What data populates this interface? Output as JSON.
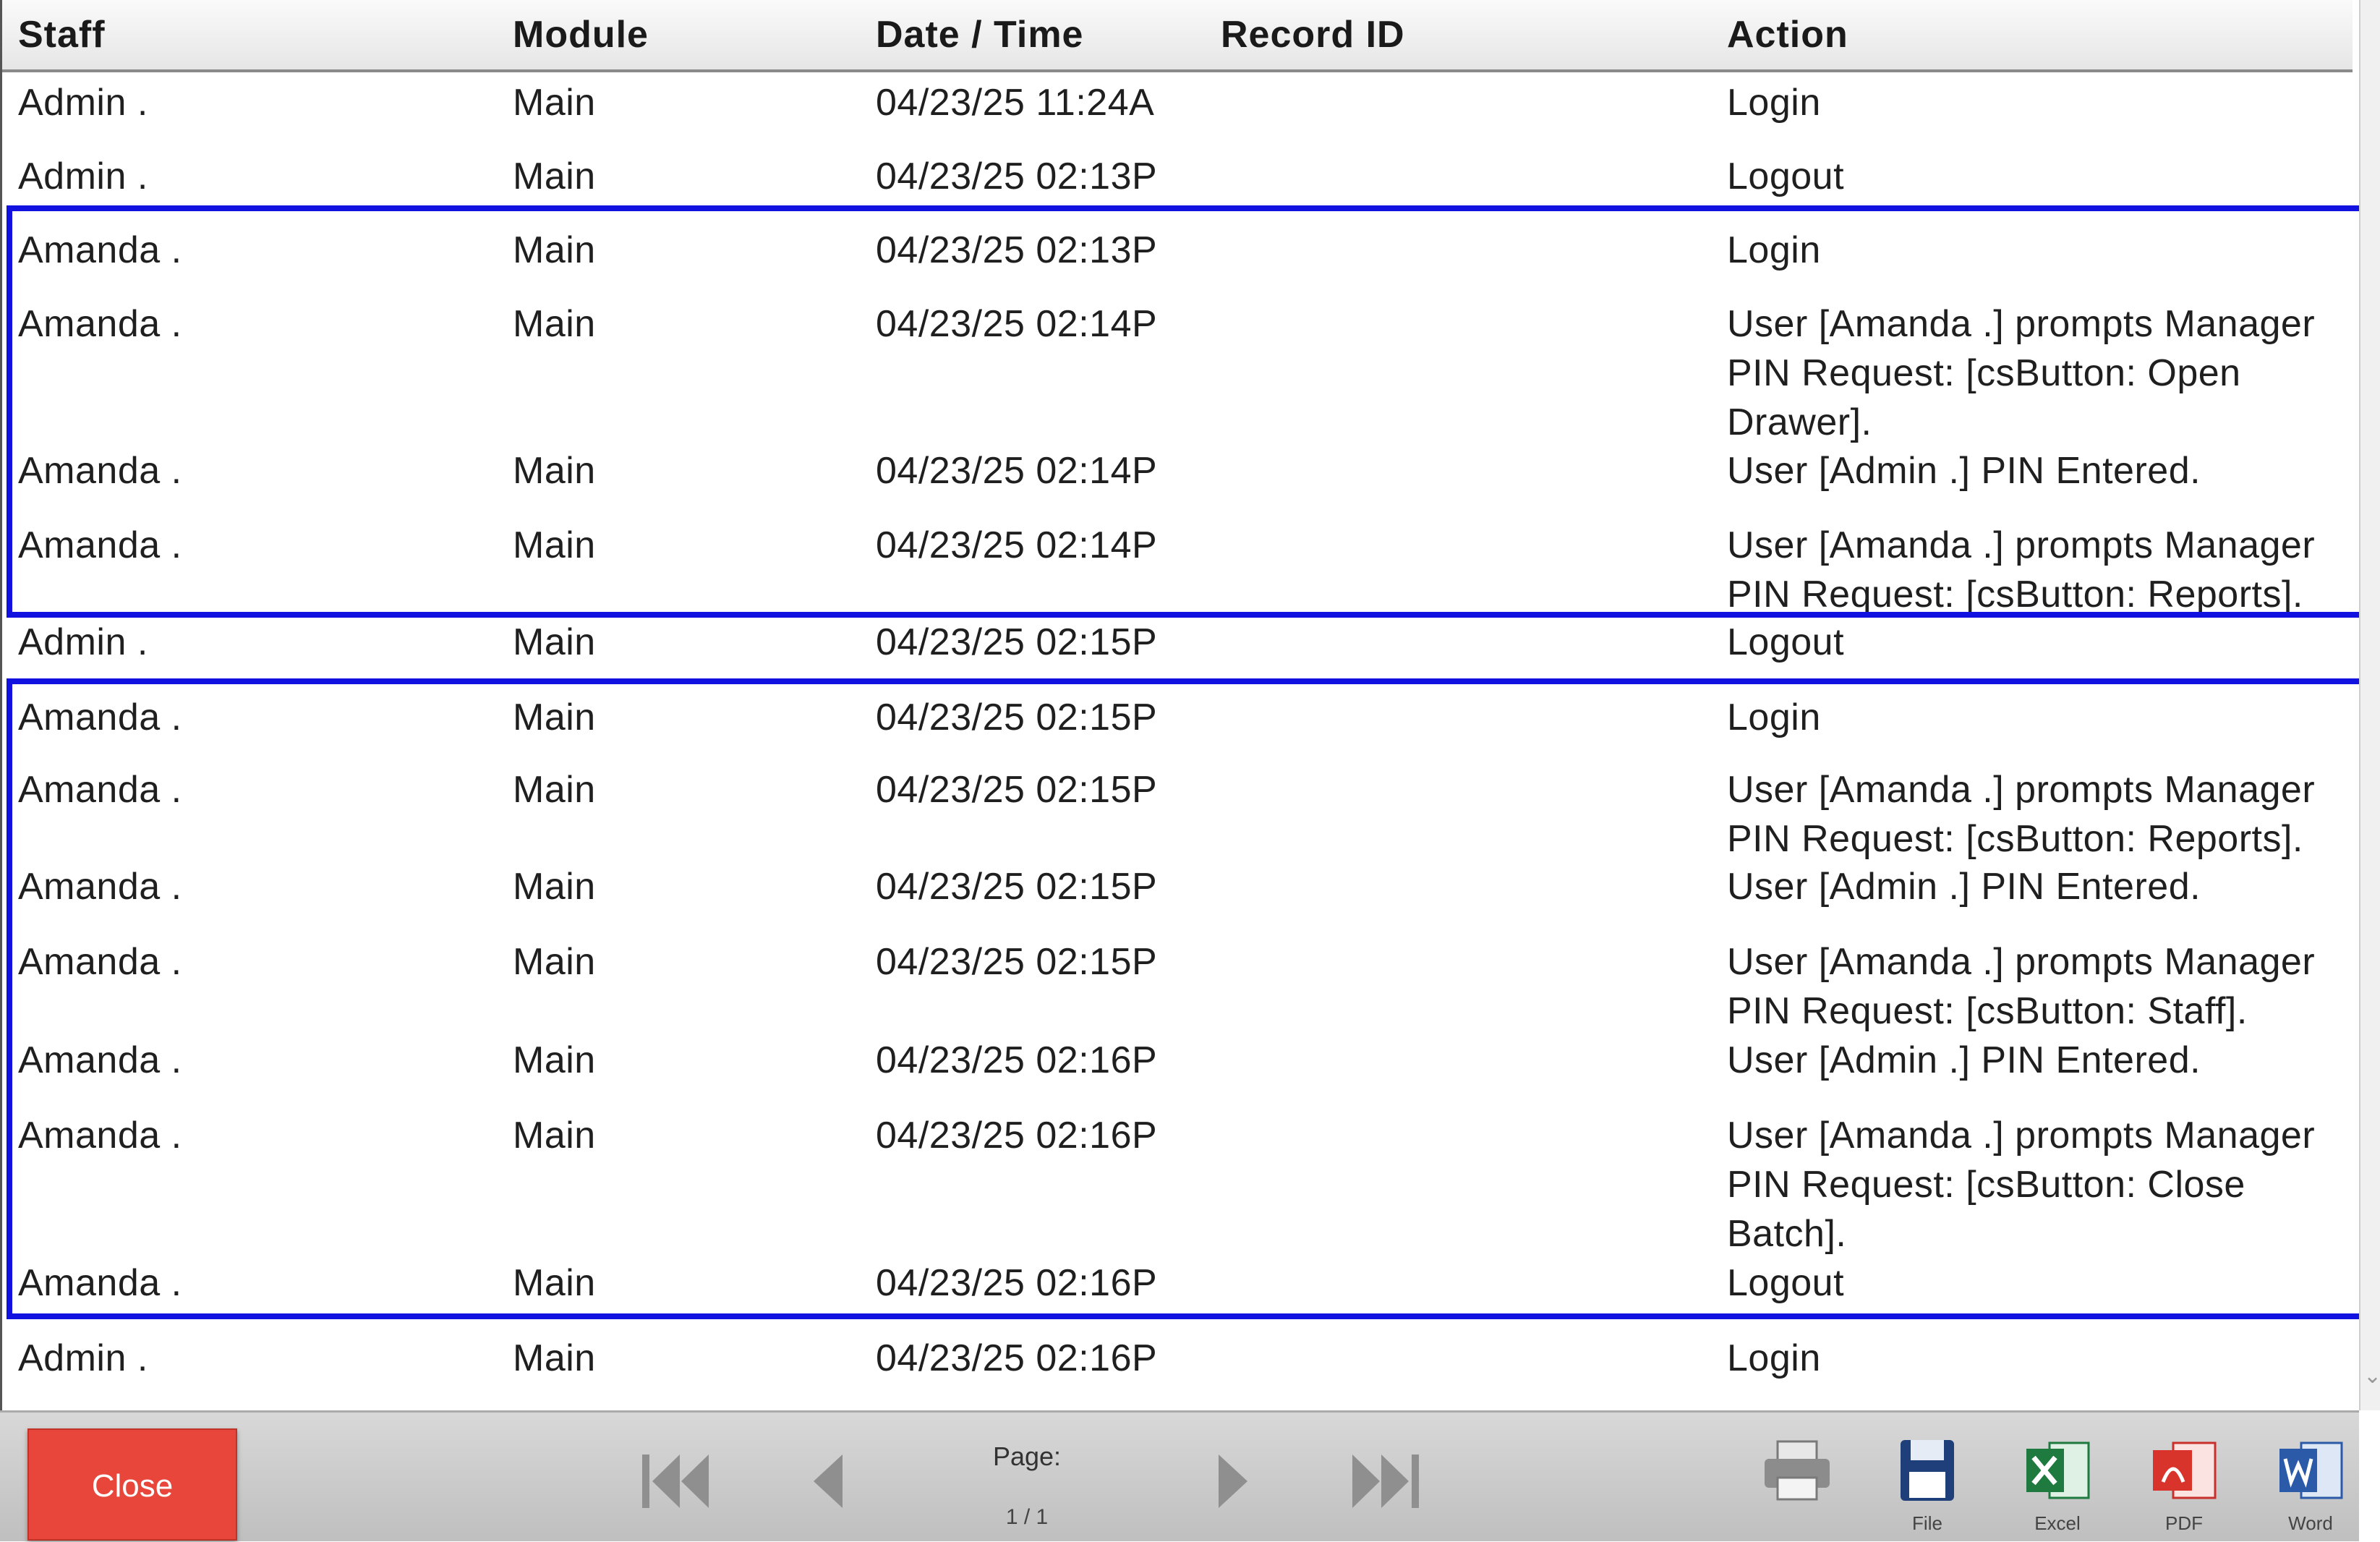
{
  "columns": {
    "staff": "Staff",
    "module": "Module",
    "date_time": "Date / Time",
    "record_id": "Record ID",
    "action": "Action"
  },
  "rows": [
    {
      "staff": "Admin .",
      "module": "Main",
      "date_time": "04/23/25 11:24A",
      "record_id": "",
      "action": "Login"
    },
    {
      "staff": "Admin .",
      "module": "Main",
      "date_time": "04/23/25 02:13P",
      "record_id": "",
      "action": "Logout"
    },
    {
      "staff": "Amanda .",
      "module": "Main",
      "date_time": "04/23/25 02:13P",
      "record_id": "",
      "action": "Login"
    },
    {
      "staff": "Amanda .",
      "module": "Main",
      "date_time": "04/23/25 02:14P",
      "record_id": "",
      "action": "User [Amanda .] prompts Manager PIN Request: [csButton: Open Drawer]."
    },
    {
      "staff": "Amanda .",
      "module": "Main",
      "date_time": "04/23/25 02:14P",
      "record_id": "",
      "action": "User [Admin .] PIN Entered."
    },
    {
      "staff": "Amanda .",
      "module": "Main",
      "date_time": "04/23/25 02:14P",
      "record_id": "",
      "action": "User [Amanda .] prompts Manager PIN Request: [csButton: Reports]."
    },
    {
      "staff": "Admin .",
      "module": "Main",
      "date_time": "04/23/25 02:15P",
      "record_id": "",
      "action": "Logout"
    },
    {
      "staff": "Amanda .",
      "module": "Main",
      "date_time": "04/23/25 02:15P",
      "record_id": "",
      "action": "Login"
    },
    {
      "staff": "Amanda .",
      "module": "Main",
      "date_time": "04/23/25 02:15P",
      "record_id": "",
      "action": "User [Amanda .] prompts Manager PIN Request: [csButton: Reports]."
    },
    {
      "staff": "Amanda .",
      "module": "Main",
      "date_time": "04/23/25 02:15P",
      "record_id": "",
      "action": "User [Admin .] PIN Entered."
    },
    {
      "staff": "Amanda .",
      "module": "Main",
      "date_time": "04/23/25 02:15P",
      "record_id": "",
      "action": "User [Amanda .] prompts Manager PIN Request: [csButton: Staff]."
    },
    {
      "staff": "Amanda .",
      "module": "Main",
      "date_time": "04/23/25 02:16P",
      "record_id": "",
      "action": "User [Admin .] PIN Entered."
    },
    {
      "staff": "Amanda .",
      "module": "Main",
      "date_time": "04/23/25 02:16P",
      "record_id": "",
      "action": "User [Amanda .] prompts Manager PIN Request: [csButton: Close Batch]."
    },
    {
      "staff": "Amanda .",
      "module": "Main",
      "date_time": "04/23/25 02:16P",
      "record_id": "",
      "action": "Logout"
    },
    {
      "staff": "Admin .",
      "module": "Main",
      "date_time": "04/23/25 02:16P",
      "record_id": "",
      "action": "Login"
    }
  ],
  "highlight_color": "#1111e0",
  "footer": {
    "close_label": "Close",
    "page_label": "Page:",
    "page_value": "1 / 1",
    "tools": [
      {
        "icon": "printer-icon",
        "label": ""
      },
      {
        "icon": "floppy-disk-icon",
        "label": "File"
      },
      {
        "icon": "excel-icon",
        "label": "Excel"
      },
      {
        "icon": "pdf-icon",
        "label": "PDF"
      },
      {
        "icon": "word-icon",
        "label": "Word"
      }
    ]
  }
}
